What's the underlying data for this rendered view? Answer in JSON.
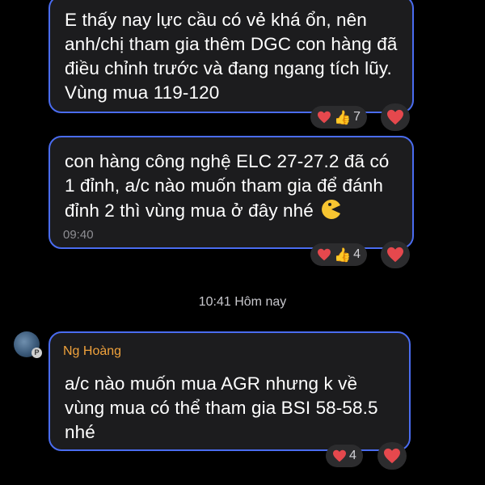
{
  "messages": [
    {
      "text": "E thấy nay lực cầu có vẻ khá ổn, nên anh/chị tham gia thêm DGC con hàng đã điều chỉnh trước và đang ngang tích lũy. Vùng mua 119-120",
      "reaction_count": "7"
    },
    {
      "text": "con hàng công nghệ ELC 27-27.2 đã có 1 đỉnh, a/c nào muốn tham gia để đánh đỉnh 2 thì vùng mua ở đây nhé",
      "time": "09:40",
      "reaction_count": "4"
    },
    {
      "sender": "Ng Hoàng",
      "text": "a/c nào muốn mua AGR nhưng k về vùng mua có thể tham gia BSI 58-58.5 nhé",
      "reaction_count": "4"
    }
  ],
  "divider": {
    "label": "10:41 Hôm nay"
  },
  "icons": [
    "heart-icon",
    "thumbs-up-icon",
    "pacman-emoji"
  ],
  "colors": {
    "bubble_border": "#4a6cf0",
    "bubble_bg": "#1c1c1e",
    "sender_name": "#f0a23c"
  }
}
